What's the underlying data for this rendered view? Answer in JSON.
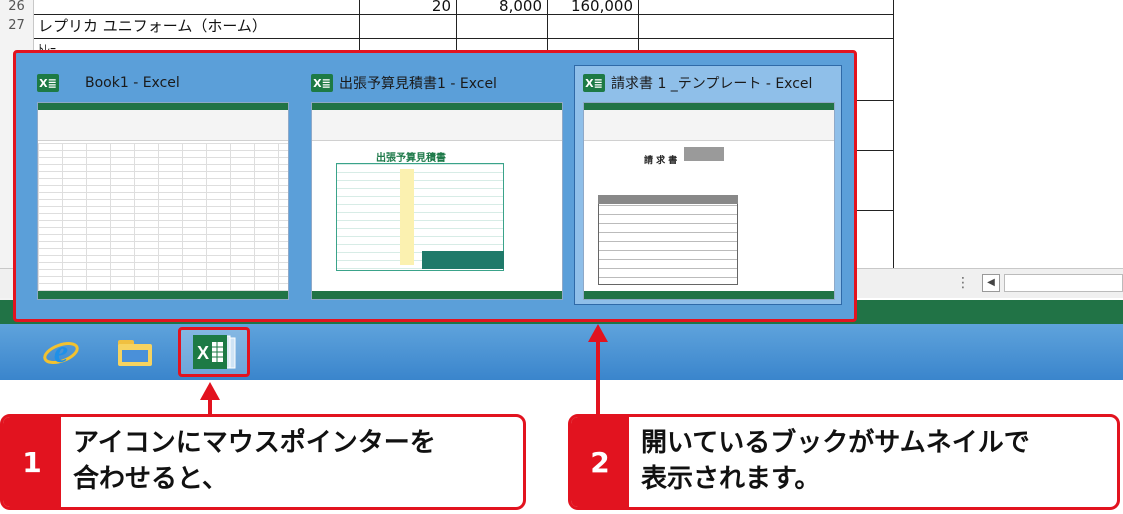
{
  "spreadsheet": {
    "row_numbers": [
      "26",
      "27",
      "2",
      "2",
      "3",
      "3",
      "3",
      "3",
      "3"
    ],
    "row27_item": "レプリカ ユニフォーム（ホーム）",
    "row26_values": [
      "20",
      "8,000",
      "160,000"
    ],
    "row28_partial": "ﾄﾚｰ"
  },
  "taskbar": {
    "items": [
      "internet-explorer",
      "file-explorer",
      "excel"
    ]
  },
  "thumbnails": [
    {
      "title": "Book1 - Excel",
      "active": false
    },
    {
      "title": "出張予算見積書1 - Excel",
      "active": false,
      "doc_heading": "出張予算見積書"
    },
    {
      "title": "請求書 1 _テンプレート - Excel",
      "active": true,
      "doc_heading": "請 求 書"
    }
  ],
  "callouts": [
    {
      "number": "1",
      "text": "アイコンにマウスポインターを\n合わせると、"
    },
    {
      "number": "2",
      "text": "開いているブックがサムネイルで\n表示されます。"
    }
  ],
  "colors": {
    "accent_red": "#e2131f",
    "excel_green": "#217346",
    "taskbar_blue": "#3a85cc"
  }
}
